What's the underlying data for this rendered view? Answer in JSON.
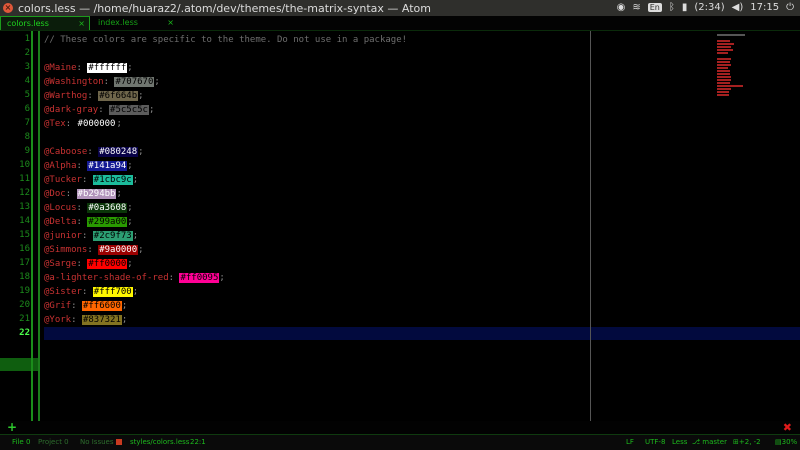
{
  "window": {
    "title": "colors.less — /home/huaraz2/.atom/dev/themes/the-matrix-syntax — Atom"
  },
  "tray": {
    "kbd": "En",
    "battery": "(2:34)",
    "time": "17:15"
  },
  "tabs": [
    {
      "label": "colors.less",
      "close": "×",
      "active": true
    },
    {
      "label": "index.less",
      "close": "×",
      "active": false
    }
  ],
  "lines": [
    {
      "num": "1",
      "comment": "// These colors are specific to the theme. Do not use in a package!"
    },
    {
      "num": "2"
    },
    {
      "num": "3",
      "var": "@Maine",
      "value": "#ffffff",
      "bg": "#ffffff",
      "fg": "#000000"
    },
    {
      "num": "4",
      "var": "@Washington",
      "value": "#707670",
      "bg": "#707670",
      "fg": "#000000"
    },
    {
      "num": "5",
      "var": "@Warthog",
      "value": "#6f664b",
      "bg": "#6f664b",
      "fg": "#000000"
    },
    {
      "num": "6",
      "var": "@dark-gray",
      "value": "#5c5c5c",
      "bg": "#5c5c5c",
      "fg": "#000000"
    },
    {
      "num": "7",
      "var": "@Tex",
      "value": "#000000",
      "bg": "#000000",
      "fg": "#ffffff"
    },
    {
      "num": "8"
    },
    {
      "num": "9",
      "var": "@Caboose",
      "value": "#080248",
      "bg": "#080248",
      "fg": "#ffffff"
    },
    {
      "num": "10",
      "var": "@Alpha",
      "value": "#141a94",
      "bg": "#141a94",
      "fg": "#ffffff"
    },
    {
      "num": "11",
      "var": "@Tucker",
      "value": "#1cbc9c",
      "bg": "#1cbc9c",
      "fg": "#000000"
    },
    {
      "num": "12",
      "var": "@Doc",
      "value": "#b294bb",
      "bg": "#b294bb",
      "fg": "#ffffff"
    },
    {
      "num": "13",
      "var": "@Locus",
      "value": "#0a3608",
      "bg": "#0a3608",
      "fg": "#ffffff"
    },
    {
      "num": "14",
      "var": "@Delta",
      "value": "#299a00",
      "bg": "#299a00",
      "fg": "#000000"
    },
    {
      "num": "15",
      "var": "@junior",
      "value": "#2c9f73",
      "bg": "#2c9f73",
      "fg": "#000000"
    },
    {
      "num": "16",
      "var": "@Simmons",
      "value": "#9a0000",
      "bg": "#9a0000",
      "fg": "#ffffff"
    },
    {
      "num": "17",
      "var": "@Sarge",
      "value": "#ff0000",
      "bg": "#ff0000",
      "fg": "#000000"
    },
    {
      "num": "18",
      "var": "@a-lighter-shade-of-red",
      "value": "#ff0095",
      "bg": "#ff0095",
      "fg": "#000000"
    },
    {
      "num": "19",
      "var": "@Sister",
      "value": "#fff700",
      "bg": "#fff700",
      "fg": "#000000"
    },
    {
      "num": "20",
      "var": "@Grif",
      "value": "#ff6600",
      "bg": "#ff6600",
      "fg": "#000000"
    },
    {
      "num": "21",
      "var": "@York",
      "value": "#837321",
      "bg": "#837321",
      "fg": "#000000"
    },
    {
      "num": "22",
      "current": true
    }
  ],
  "bottom": {
    "add": "+",
    "close": "✖"
  },
  "status": {
    "file": "File 0",
    "project": "Project 0",
    "issues": "No Issues",
    "path": "styles/colors.less",
    "cursor": "22:1",
    "line_ending": "LF",
    "encoding": "UTF-8",
    "grammar": "Less",
    "branch": "master",
    "diff": "+2, -2",
    "zoom": "30%"
  },
  "colors": {
    "accent": "#1fd41f",
    "gutter_border": "#1b8d1b",
    "current_line": "#020a3e",
    "variable": "#c83232"
  }
}
